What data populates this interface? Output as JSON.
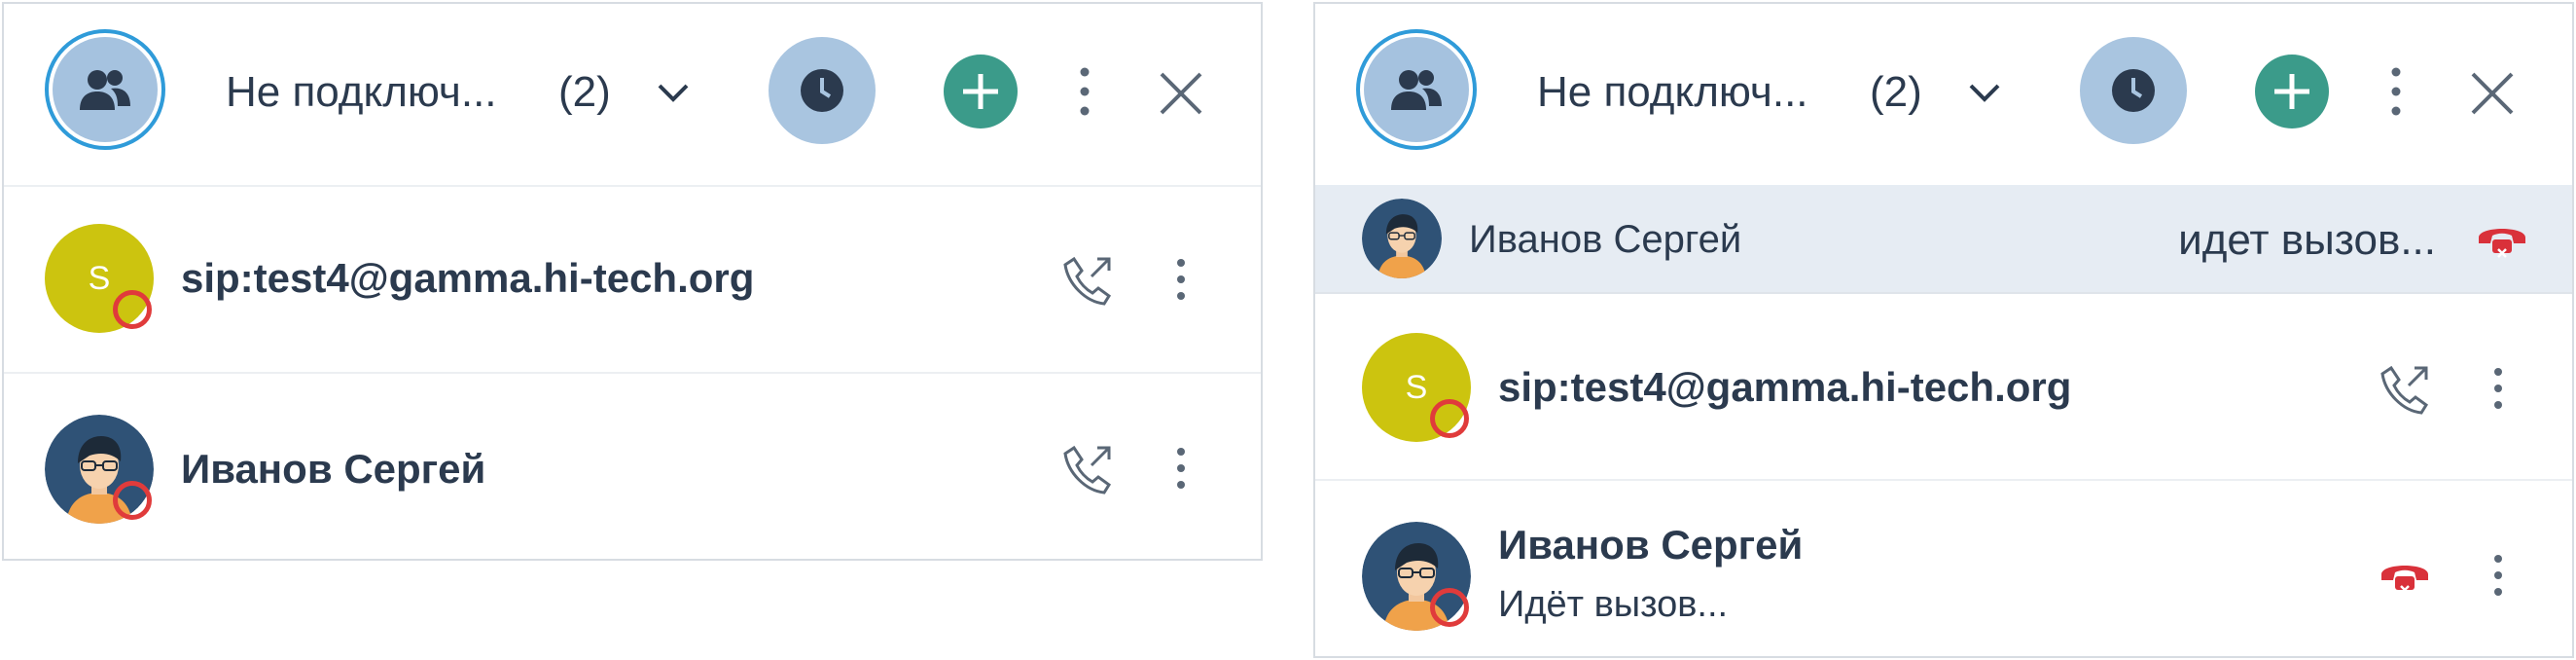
{
  "colors": {
    "accent_blue": "#2f9bd9",
    "group_avatar_bg": "#a5c2df",
    "history_bg": "#a9c5e0",
    "add_green": "#3b9b8a",
    "letter_avatar_yellow": "#ccc40f",
    "offline_red": "#e03b3b",
    "hangup_red": "#d9313a",
    "active_call_bg": "#e6ecf3"
  },
  "panels": [
    {
      "header": {
        "status_title": "Не подключ...",
        "count": "(2)"
      },
      "contacts": [
        {
          "avatar_letter": "S",
          "name": "sip:test4@gamma.hi-tech.org",
          "action_icon": "phone-outgoing-icon"
        },
        {
          "avatar_icon": "user-avatar",
          "name": "Иванов Сергей",
          "action_icon": "phone-outgoing-icon"
        }
      ]
    },
    {
      "header": {
        "status_title": "Не подключ...",
        "count": "(2)"
      },
      "active_call": {
        "name": "Иванов Сергей",
        "status": "идет вызов..."
      },
      "contacts": [
        {
          "avatar_letter": "S",
          "name": "sip:test4@gamma.hi-tech.org",
          "action_icon": "phone-outgoing-icon"
        },
        {
          "avatar_icon": "user-avatar",
          "name": "Иванов Сергей",
          "sub": "Идёт вызов...",
          "action_icon": "hangup-icon"
        }
      ]
    }
  ]
}
